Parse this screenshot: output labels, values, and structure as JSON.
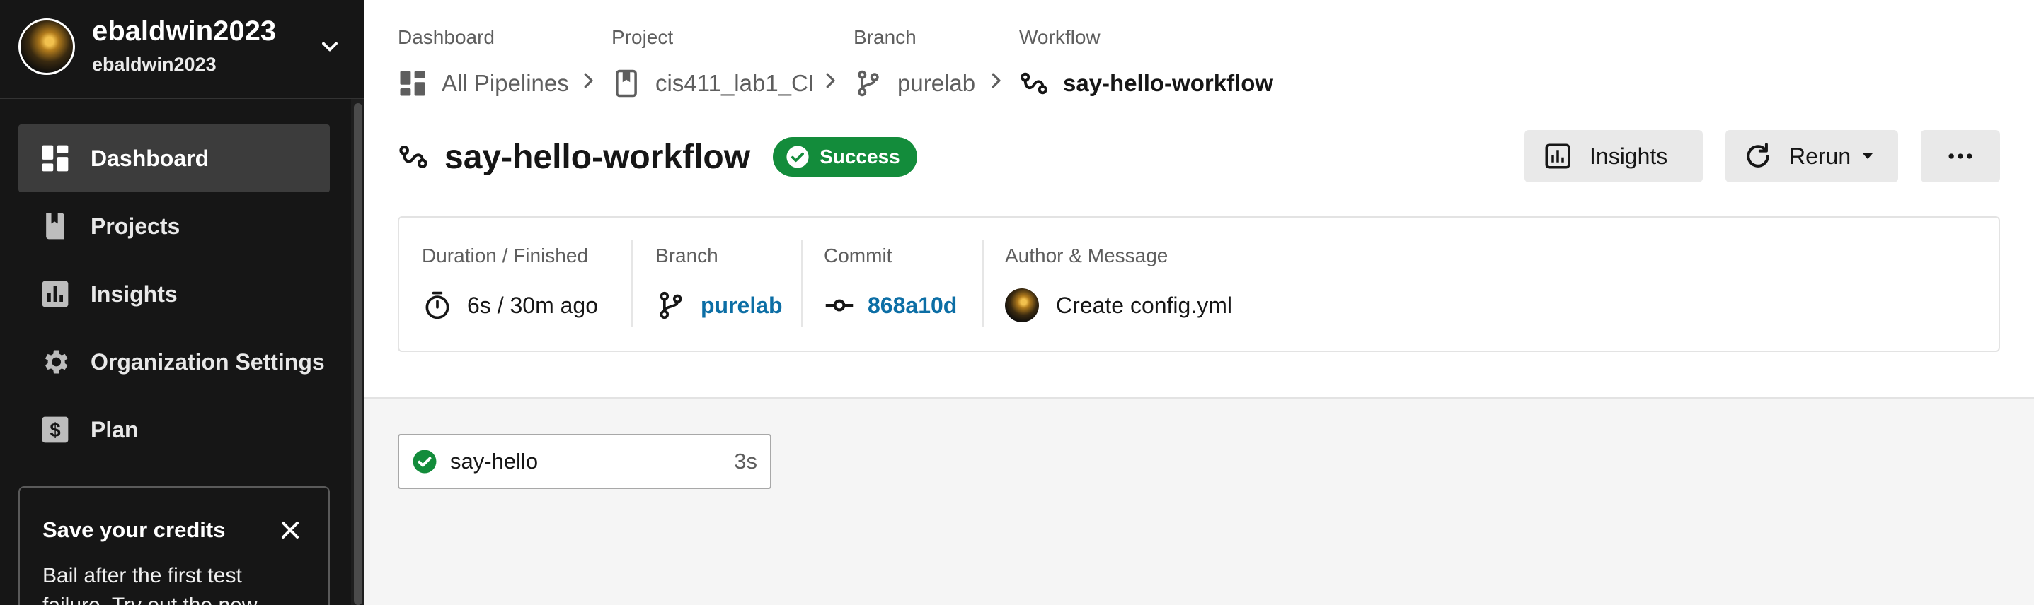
{
  "user": {
    "name": "ebaldwin2023",
    "org": "ebaldwin2023"
  },
  "sidebar": {
    "items": [
      {
        "label": "Dashboard",
        "icon": "dashboard-icon",
        "active": true
      },
      {
        "label": "Projects",
        "icon": "projects-icon",
        "active": false
      },
      {
        "label": "Insights",
        "icon": "insights-icon",
        "active": false
      },
      {
        "label": "Organization Settings",
        "icon": "gear-icon",
        "active": false
      },
      {
        "label": "Plan",
        "icon": "dollar-icon",
        "active": false
      }
    ],
    "promo": {
      "title": "Save your credits",
      "text": "Bail after the first test failure. Try out the new"
    }
  },
  "breadcrumb": [
    {
      "heading": "Dashboard",
      "label": "All Pipelines",
      "icon": "dashboard-icon"
    },
    {
      "heading": "Project",
      "label": "cis411_lab1_CI",
      "icon": "bookmark-icon"
    },
    {
      "heading": "Branch",
      "label": "purelab",
      "icon": "branch-icon"
    },
    {
      "heading": "Workflow",
      "label": "say-hello-workflow",
      "icon": "workflow-icon"
    }
  ],
  "header": {
    "title": "say-hello-workflow",
    "status": "Success",
    "insights_label": "Insights",
    "rerun_label": "Rerun",
    "more_label": "..."
  },
  "details": {
    "duration_heading": "Duration / Finished",
    "duration_value": "6s / 30m ago",
    "branch_heading": "Branch",
    "branch_value": "purelab",
    "commit_heading": "Commit",
    "commit_value": "868a10d",
    "author_heading": "Author & Message",
    "message": "Create config.yml"
  },
  "jobs": [
    {
      "name": "say-hello",
      "duration": "3s",
      "status": "success"
    }
  ],
  "colors": {
    "sidebar_bg": "#161616",
    "success": "#138c3b",
    "link": "#0c6ea5"
  }
}
